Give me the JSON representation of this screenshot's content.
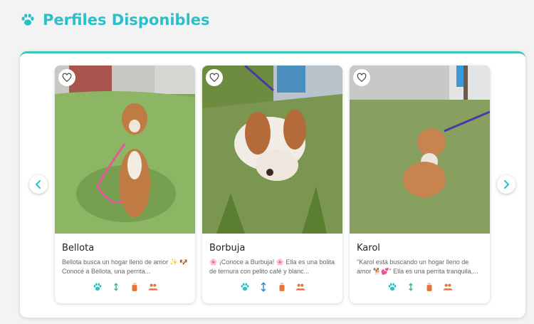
{
  "section": {
    "title": "Perfiles Disponibles"
  },
  "colors": {
    "accent": "#2bbfc9",
    "orange": "#e8743b",
    "green": "#3fbf7f",
    "panel_border": "#39c6b6"
  },
  "icons": {
    "header": "paw-icon",
    "prev": "chevron-left-icon",
    "next": "chevron-right-icon",
    "favorite": "heart-outline-icon"
  },
  "cards": [
    {
      "name": "Bellota",
      "description": "Bellota busca un hogar lleno de amor ✨ 🐶 Conocé a Bellota, una perrita...",
      "trait_icons": [
        "paw-icon",
        "height-arrow-icon",
        "bottle-icon",
        "people-icon"
      ]
    },
    {
      "name": "Borbuja",
      "description": "🌸 ¡Conoce a Burbuja! 🌸 Ella es una bolita de ternura con pelito café y blanc...",
      "trait_icons": [
        "paw-icon",
        "height-arrow-icon",
        "bottle-icon",
        "people-icon"
      ]
    },
    {
      "name": "Karol",
      "description": "\"Karol está buscando un hogar lleno de amor 🐕💕\" Ella es una perrita tranquila,...",
      "trait_icons": [
        "paw-icon",
        "height-arrow-icon",
        "bottle-icon",
        "people-icon"
      ]
    }
  ]
}
